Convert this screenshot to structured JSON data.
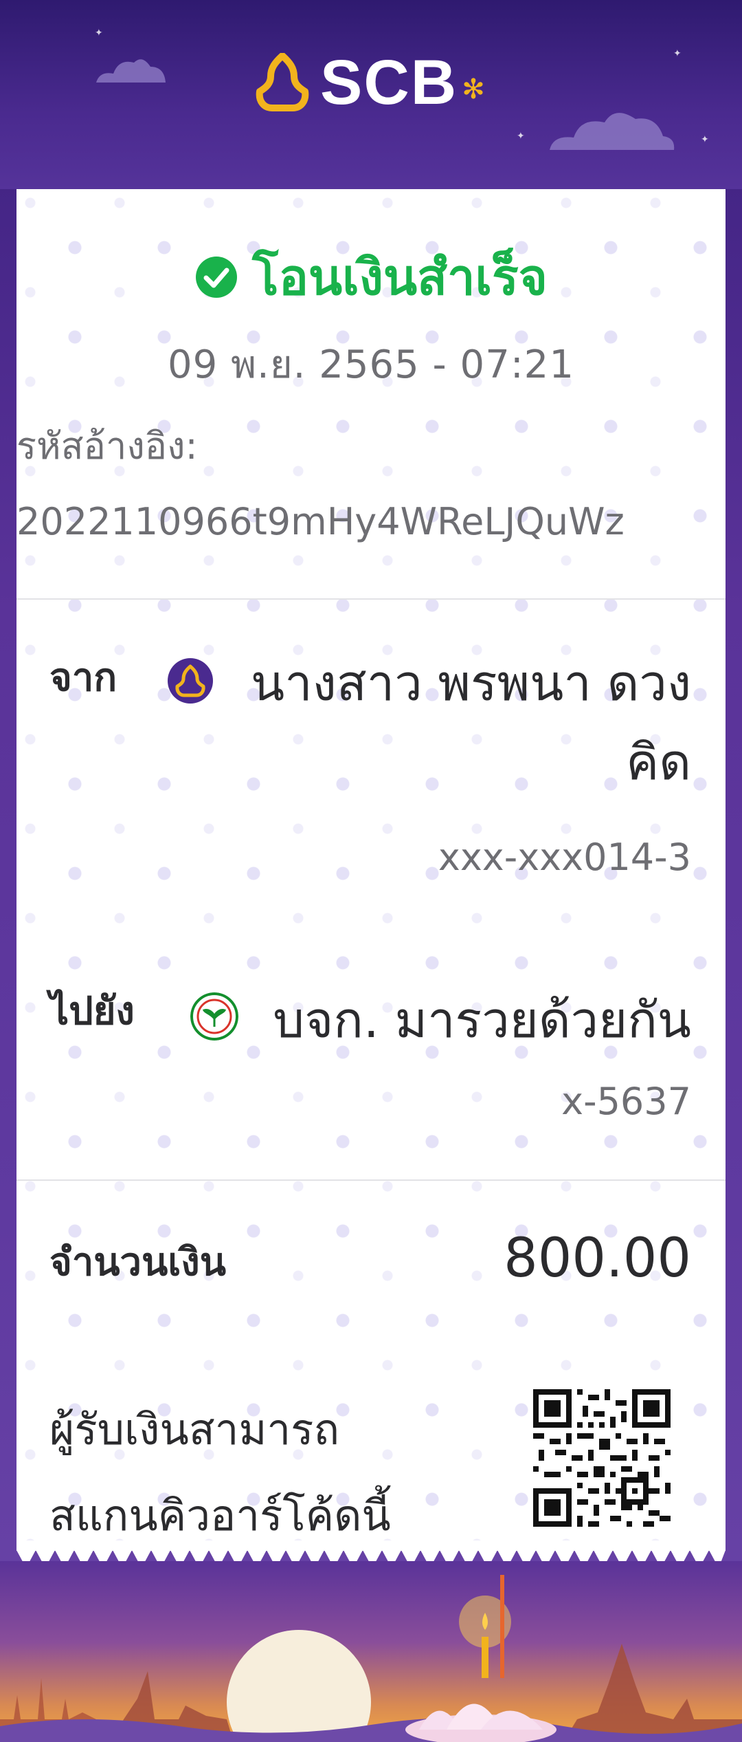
{
  "brand": {
    "name": "SCB"
  },
  "status": {
    "text": "โอนเงินสำเร็จ"
  },
  "datetime": "09 พ.ย. 2565 - 07:21",
  "reference": {
    "label": "รหัสอ้างอิง:",
    "value": "2022110966t9mHy4WReLJQuWz"
  },
  "from": {
    "label": "จาก",
    "name_line1": "นางสาว พรพนา ดวง",
    "name_line2": "คิด",
    "account": "xxx-xxx014-3",
    "bank_icon": "scb-icon"
  },
  "to": {
    "label": "ไปยัง",
    "name": "บจก. มารวยด้วยกัน",
    "account": "x-5637",
    "bank_icon": "kbank-icon"
  },
  "amount": {
    "label": "จำนวนเงิน",
    "value": "800.00"
  },
  "qr_note": {
    "line1": "ผู้รับเงินสามารถ",
    "line2": "สแกนคิวอาร์โค้ดนี้"
  },
  "colors": {
    "success": "#19b24b",
    "scb_purple": "#4a2a8f",
    "scb_gold": "#f2b31d",
    "kbank_green": "#138f2d"
  }
}
